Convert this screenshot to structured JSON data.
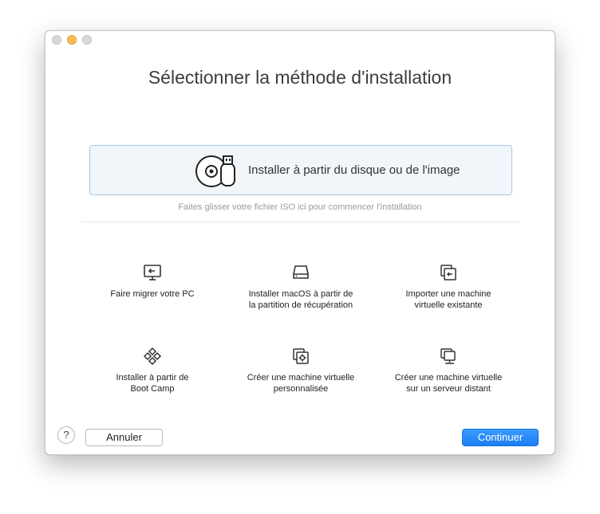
{
  "window": {
    "title": "Sélectionner la méthode d'installation"
  },
  "primary": {
    "label": "Installer à partir du disque ou de l'image",
    "icon": "disc-usb-icon",
    "hint": "Faites glisser votre fichier ISO ici pour commencer l'installation"
  },
  "options": [
    {
      "label": "Faire migrer votre PC",
      "icon": "migrate-pc-icon"
    },
    {
      "label": "Installer macOS à partir de\nla partition de récupération",
      "icon": "hard-drive-icon"
    },
    {
      "label": "Importer une machine\nvirtuelle existante",
      "icon": "import-vm-icon"
    },
    {
      "label": "Installer à partir de\nBoot Camp",
      "icon": "boot-camp-icon"
    },
    {
      "label": "Créer une machine virtuelle\npersonnalisée",
      "icon": "custom-vm-icon"
    },
    {
      "label": "Créer une machine virtuelle\nsur un serveur distant",
      "icon": "remote-server-icon"
    }
  ],
  "footer": {
    "help_label": "?",
    "cancel_label": "Annuler",
    "continue_label": "Continuer"
  },
  "colors": {
    "accent": "#1a7ef5",
    "primary_bg": "#f1f6fb",
    "primary_border": "#a9c9e6"
  }
}
